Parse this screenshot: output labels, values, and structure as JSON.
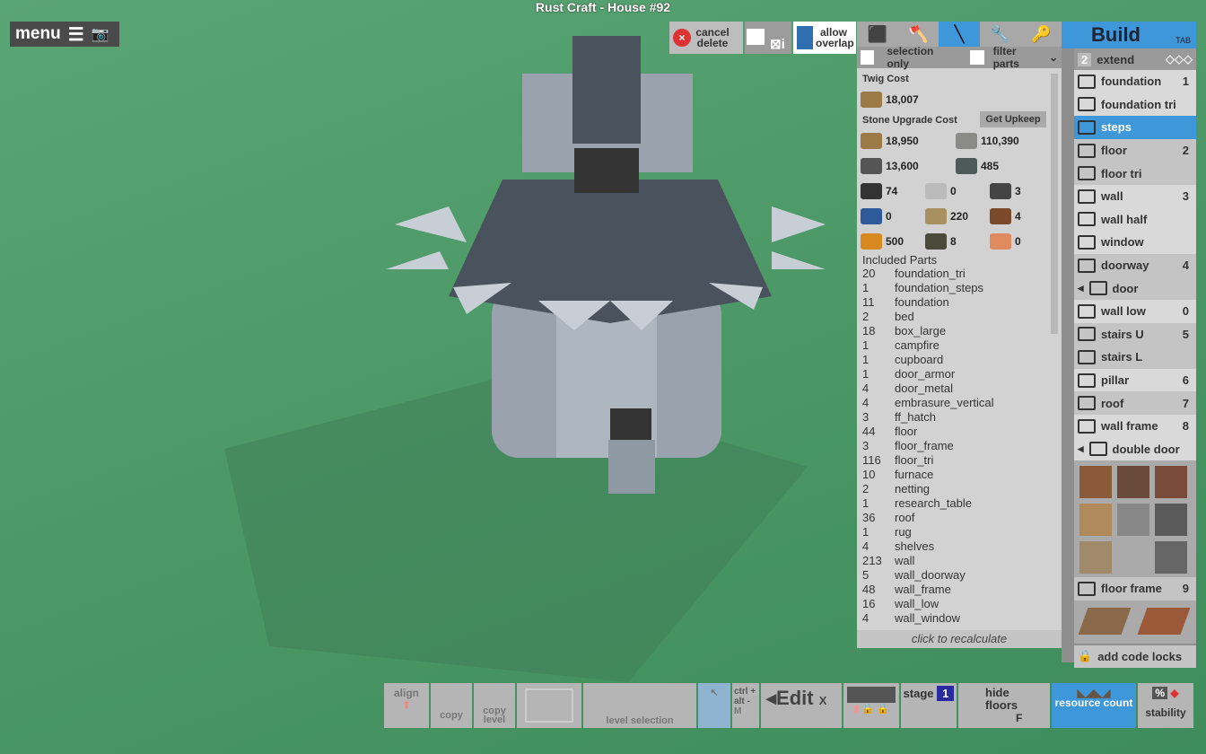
{
  "window_title": "Rust Craft - House #92",
  "menu": {
    "label": "menu",
    "icons": [
      "hamburger-icon",
      "camera-icon"
    ]
  },
  "toolbar": {
    "cancel_delete": "cancel delete",
    "allow_overlap": "allow overlap",
    "tools": [
      "cube-icon",
      "hatchet-icon",
      "hammer-icon",
      "wrench-icon",
      "key-icon"
    ],
    "active_tool": 2
  },
  "filters": {
    "selection_only": "selection only",
    "filter_parts": "filter parts",
    "selection_only_checked": false,
    "filter_parts_checked": false
  },
  "cost": {
    "twig_label": "Twig Cost",
    "twig_value": "18,007",
    "stone_label": "Stone Upgrade Cost",
    "get_upkeep": "Get Upkeep",
    "resources": [
      {
        "icon": "wood-icon",
        "value": "18,950",
        "color": "#9b7a45"
      },
      {
        "icon": "stone-icon",
        "value": "110,390",
        "color": "#8a8a88"
      },
      {
        "icon": "metal-fragments-icon",
        "value": "13,600",
        "color": "#555"
      },
      {
        "icon": "hq-metal-icon",
        "value": "485",
        "color": "#4d5a5a"
      },
      {
        "icon": "gears-icon",
        "value": "74",
        "color": "#333"
      },
      {
        "icon": "sheet-metal-icon",
        "value": "0",
        "color": "#bbb"
      },
      {
        "icon": "rope-icon",
        "value": "3",
        "color": "#444"
      },
      {
        "icon": "tarp-icon",
        "value": "0",
        "color": "#2e5a9a"
      },
      {
        "icon": "cloth-icon",
        "value": "220",
        "color": "#a89060"
      },
      {
        "icon": "pipe-icon",
        "value": "4",
        "color": "#7a4a2a"
      },
      {
        "icon": "low-grade-fuel-icon",
        "value": "500",
        "color": "#d88a20"
      },
      {
        "icon": "rope-coil-icon",
        "value": "8",
        "color": "#4a4a3a"
      },
      {
        "icon": "leather-icon",
        "value": "0",
        "color": "#e08a60"
      }
    ],
    "included_label": "Included Parts",
    "parts": [
      [
        "20",
        "foundation_tri"
      ],
      [
        "1",
        "foundation_steps"
      ],
      [
        "11",
        "foundation"
      ],
      [
        "2",
        "bed"
      ],
      [
        "18",
        "box_large"
      ],
      [
        "1",
        "campfire"
      ],
      [
        "1",
        "cupboard"
      ],
      [
        "1",
        "door_armor"
      ],
      [
        "4",
        "door_metal"
      ],
      [
        "4",
        "embrasure_vertical"
      ],
      [
        "3",
        "ff_hatch"
      ],
      [
        "44",
        "floor"
      ],
      [
        "3",
        "floor_frame"
      ],
      [
        "116",
        "floor_tri"
      ],
      [
        "10",
        "furnace"
      ],
      [
        "2",
        "netting"
      ],
      [
        "1",
        "research_table"
      ],
      [
        "36",
        "roof"
      ],
      [
        "1",
        "rug"
      ],
      [
        "4",
        "shelves"
      ],
      [
        "213",
        "wall"
      ],
      [
        "5",
        "wall_doorway"
      ],
      [
        "48",
        "wall_frame"
      ],
      [
        "16",
        "wall_low"
      ],
      [
        "4",
        "wall_window"
      ]
    ],
    "recalc": "click to recalculate"
  },
  "build": {
    "title": "Build",
    "tab_hint": "TAB",
    "extend_num": "2",
    "extend": "extend",
    "items": [
      {
        "label": "foundation",
        "key": "1",
        "bg": "#d9d9d9"
      },
      {
        "label": "foundation tri",
        "key": "",
        "bg": "#d9d9d9"
      },
      {
        "label": "steps",
        "key": "",
        "bg": "#3d97d8"
      },
      {
        "label": "floor",
        "key": "2",
        "bg": "#c4c4c4"
      },
      {
        "label": "floor tri",
        "key": "",
        "bg": "#c4c4c4"
      },
      {
        "label": "wall",
        "key": "3",
        "bg": "#d9d9d9"
      },
      {
        "label": "wall half",
        "key": "",
        "bg": "#d9d9d9"
      },
      {
        "label": "window",
        "key": "",
        "bg": "#d9d9d9"
      },
      {
        "label": "doorway",
        "key": "4",
        "bg": "#c4c4c4"
      },
      {
        "label": "door",
        "key": "",
        "bg": "#c4c4c4"
      },
      {
        "label": "wall low",
        "key": "0",
        "bg": "#d9d9d9"
      },
      {
        "label": "stairs U",
        "key": "5",
        "bg": "#c4c4c4"
      },
      {
        "label": "stairs L",
        "key": "",
        "bg": "#c4c4c4"
      },
      {
        "label": "pillar",
        "key": "6",
        "bg": "#d9d9d9"
      },
      {
        "label": "roof",
        "key": "7",
        "bg": "#c4c4c4"
      },
      {
        "label": "wall frame",
        "key": "8",
        "bg": "#d9d9d9"
      },
      {
        "label": "double door",
        "key": "",
        "bg": "#d9d9d9"
      }
    ],
    "floor_frame": "floor frame",
    "floor_frame_key": "9",
    "code_locks": "add code locks"
  },
  "bottom": {
    "align": "align",
    "copy": "copy",
    "copy_level": "copy level",
    "level_selection": "level selection",
    "ctrl": "ctrl +",
    "alt": "alt -",
    "m": "M",
    "edit": "Edit",
    "x": "X",
    "stage": "stage",
    "stage_num": "1",
    "hide": "hide",
    "floors": "floors",
    "f": "F",
    "resource_count": "resource count",
    "percent": "%",
    "stability": "stability"
  }
}
